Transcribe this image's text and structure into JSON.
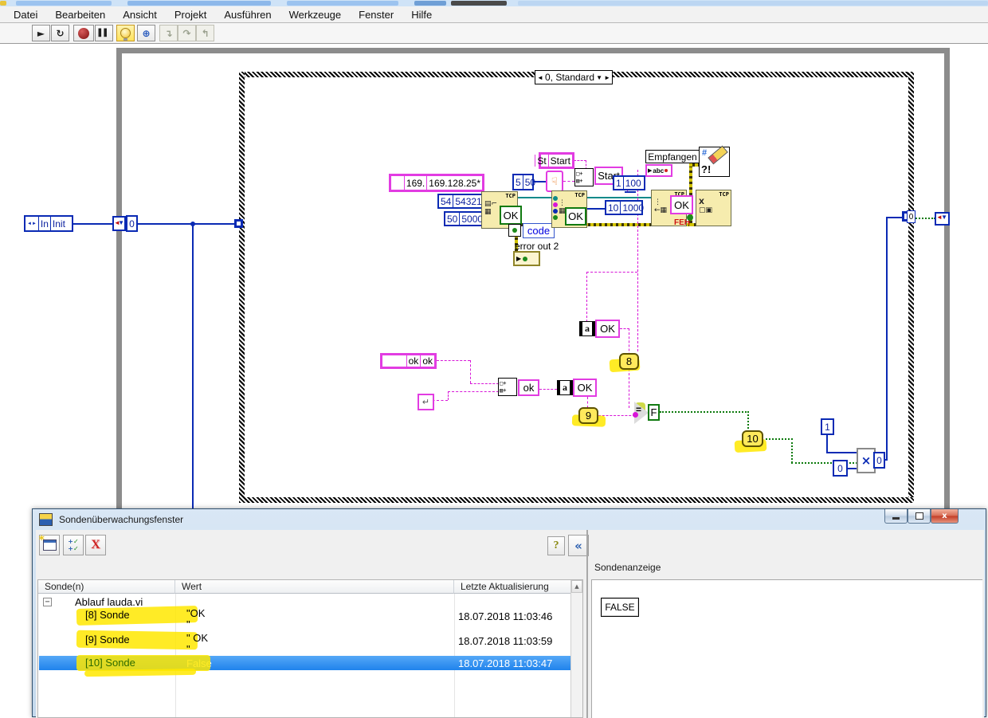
{
  "menu": {
    "items": [
      "Datei",
      "Bearbeiten",
      "Ansicht",
      "Projekt",
      "Ausführen",
      "Werkzeuge",
      "Fenster",
      "Hilfe"
    ]
  },
  "icons": {
    "run": "►",
    "run_continuous": "↻",
    "pause": "▌▌",
    "step_into": "↴",
    "step_over": "↷",
    "step_out": "↰",
    "retain": "⊕",
    "help": "?",
    "collapse": "«",
    "close": "x",
    "restore": "❐",
    "new_probe_star": "*",
    "add_plus": "+",
    "add_check": "✓",
    "delete_x": "X",
    "expander_minus": "−",
    "scroll_up": "▲",
    "hand": "☟",
    "eol": "↵",
    "concat_row1": "□+",
    "concat_row2": "▨+",
    "play": "▶",
    "abc": "abc",
    "hash": "#",
    "qmark_excl": "?!",
    "case_left": "◄",
    "case_right": "►",
    "case_drop": "▼",
    "enum_arrows": "◄►",
    "select_x": "×",
    "sr_arrow": "▼"
  },
  "diagram": {
    "case_selector": "0, Standard",
    "tcp": "TCP",
    "enum_probe": "In",
    "enum_value": "Init",
    "sr_probe_left": "0",
    "ip_probe": "169.",
    "ip_value": "169.128.25*",
    "p54_probe": "54",
    "p54_value": "54321",
    "p50_probe": "50",
    "p50_value": "5000",
    "p5_probe": "5",
    "p5_value": "50",
    "st_probe": "St",
    "st_value": "Start",
    "start_probe": "Start",
    "n1_probe": "1",
    "n1_value": "100",
    "n10_probe": "10",
    "n10_value": "1000",
    "ok1": "OK",
    "ok2": "OK",
    "ok3": "OK",
    "ok4": "OK",
    "ok5": "OK",
    "ok_const_probe": "ok",
    "ok_const_value": "ok",
    "ok_lower": "ok",
    "code_label": "code",
    "error_out_label": "error out 2",
    "empfangen_label": "Empfangen",
    "feh_fragment": "FEH",
    "eq_sign": "=",
    "eq_probe": "F",
    "a_glyph": "a",
    "probe8": "8",
    "probe9": "9",
    "probe10": "10",
    "sel_top": "1",
    "sel_bottom": "0",
    "sel_out": "0",
    "tunnel_probe": "0"
  },
  "probe_window": {
    "title": "Sondenüberwachungsfenster",
    "columns": [
      "Sonde(n)",
      "Wert",
      "Letzte Aktualisierung"
    ],
    "tree_root": "Ablauf lauda.vi",
    "rows": [
      {
        "name": "[8] Sonde",
        "value1": "\"OK",
        "value2": "\"",
        "updated": "18.07.2018 11:03:46"
      },
      {
        "name": "[9] Sonde",
        "value1": "\" OK",
        "value2": "\"",
        "updated": "18.07.2018 11:03:59"
      },
      {
        "name": "[10] Sonde",
        "value1": "False",
        "value2": "",
        "updated": "18.07.2018 11:03:47"
      }
    ],
    "right_panel": {
      "label": "Sondenanzeige",
      "value": "FALSE"
    }
  },
  "colors": {
    "string_pink": "#e23ce2",
    "numeric_blue": "#0a2ab4",
    "bool_green": "#117a11",
    "error_yellow": "#d3c400",
    "selection_blue": "#2f96f3",
    "marker_yellow": "#ffe800",
    "node_tan": "#f6ecae",
    "loop_gray": "#8c8c8c"
  }
}
